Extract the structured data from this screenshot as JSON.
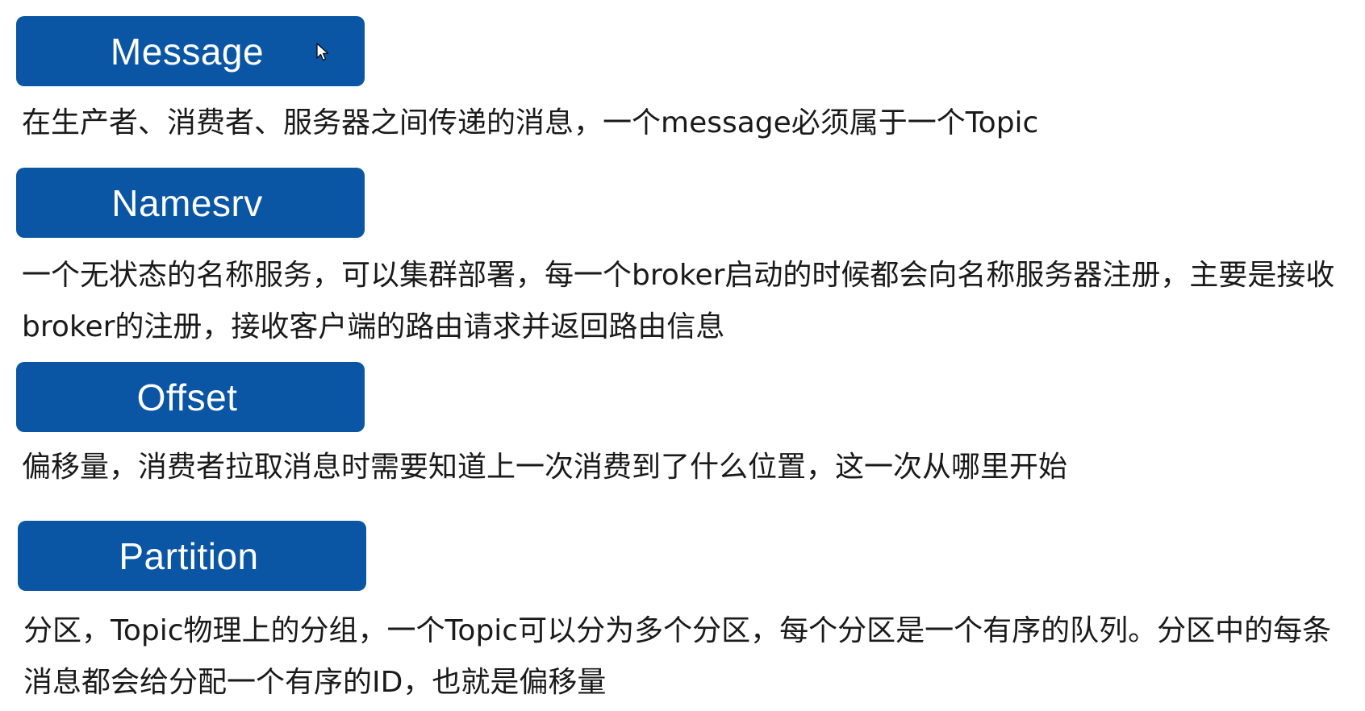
{
  "sections": [
    {
      "term": "Message",
      "lines": [
        "在生产者、消费者、服务器之间传递的消息，一个message必须属于一个Topic"
      ]
    },
    {
      "term": "Namesrv",
      "lines": [
        "一个无状态的名称服务，可以集群部署，每一个broker启动的时候都会向名称服务器注册，主要是接收",
        "broker的注册，接收客户端的路由请求并返回路由信息"
      ]
    },
    {
      "term": "Offset",
      "lines": [
        "偏移量，消费者拉取消息时需要知道上一次消费到了什么位置，这一次从哪里开始"
      ]
    },
    {
      "term": "Partition",
      "lines": [
        "分区，Topic物理上的分组，一个Topic可以分为多个分区，每个分区是一个有序的队列。分区中的每条",
        "消息都会给分配一个有序的ID，也就是偏移量"
      ]
    }
  ],
  "colors": {
    "term_background": "#0a56a4",
    "term_text": "#ffffff",
    "body_text": "#1a1a1a"
  },
  "icons": {
    "cursor": "mouse-pointer-icon"
  }
}
